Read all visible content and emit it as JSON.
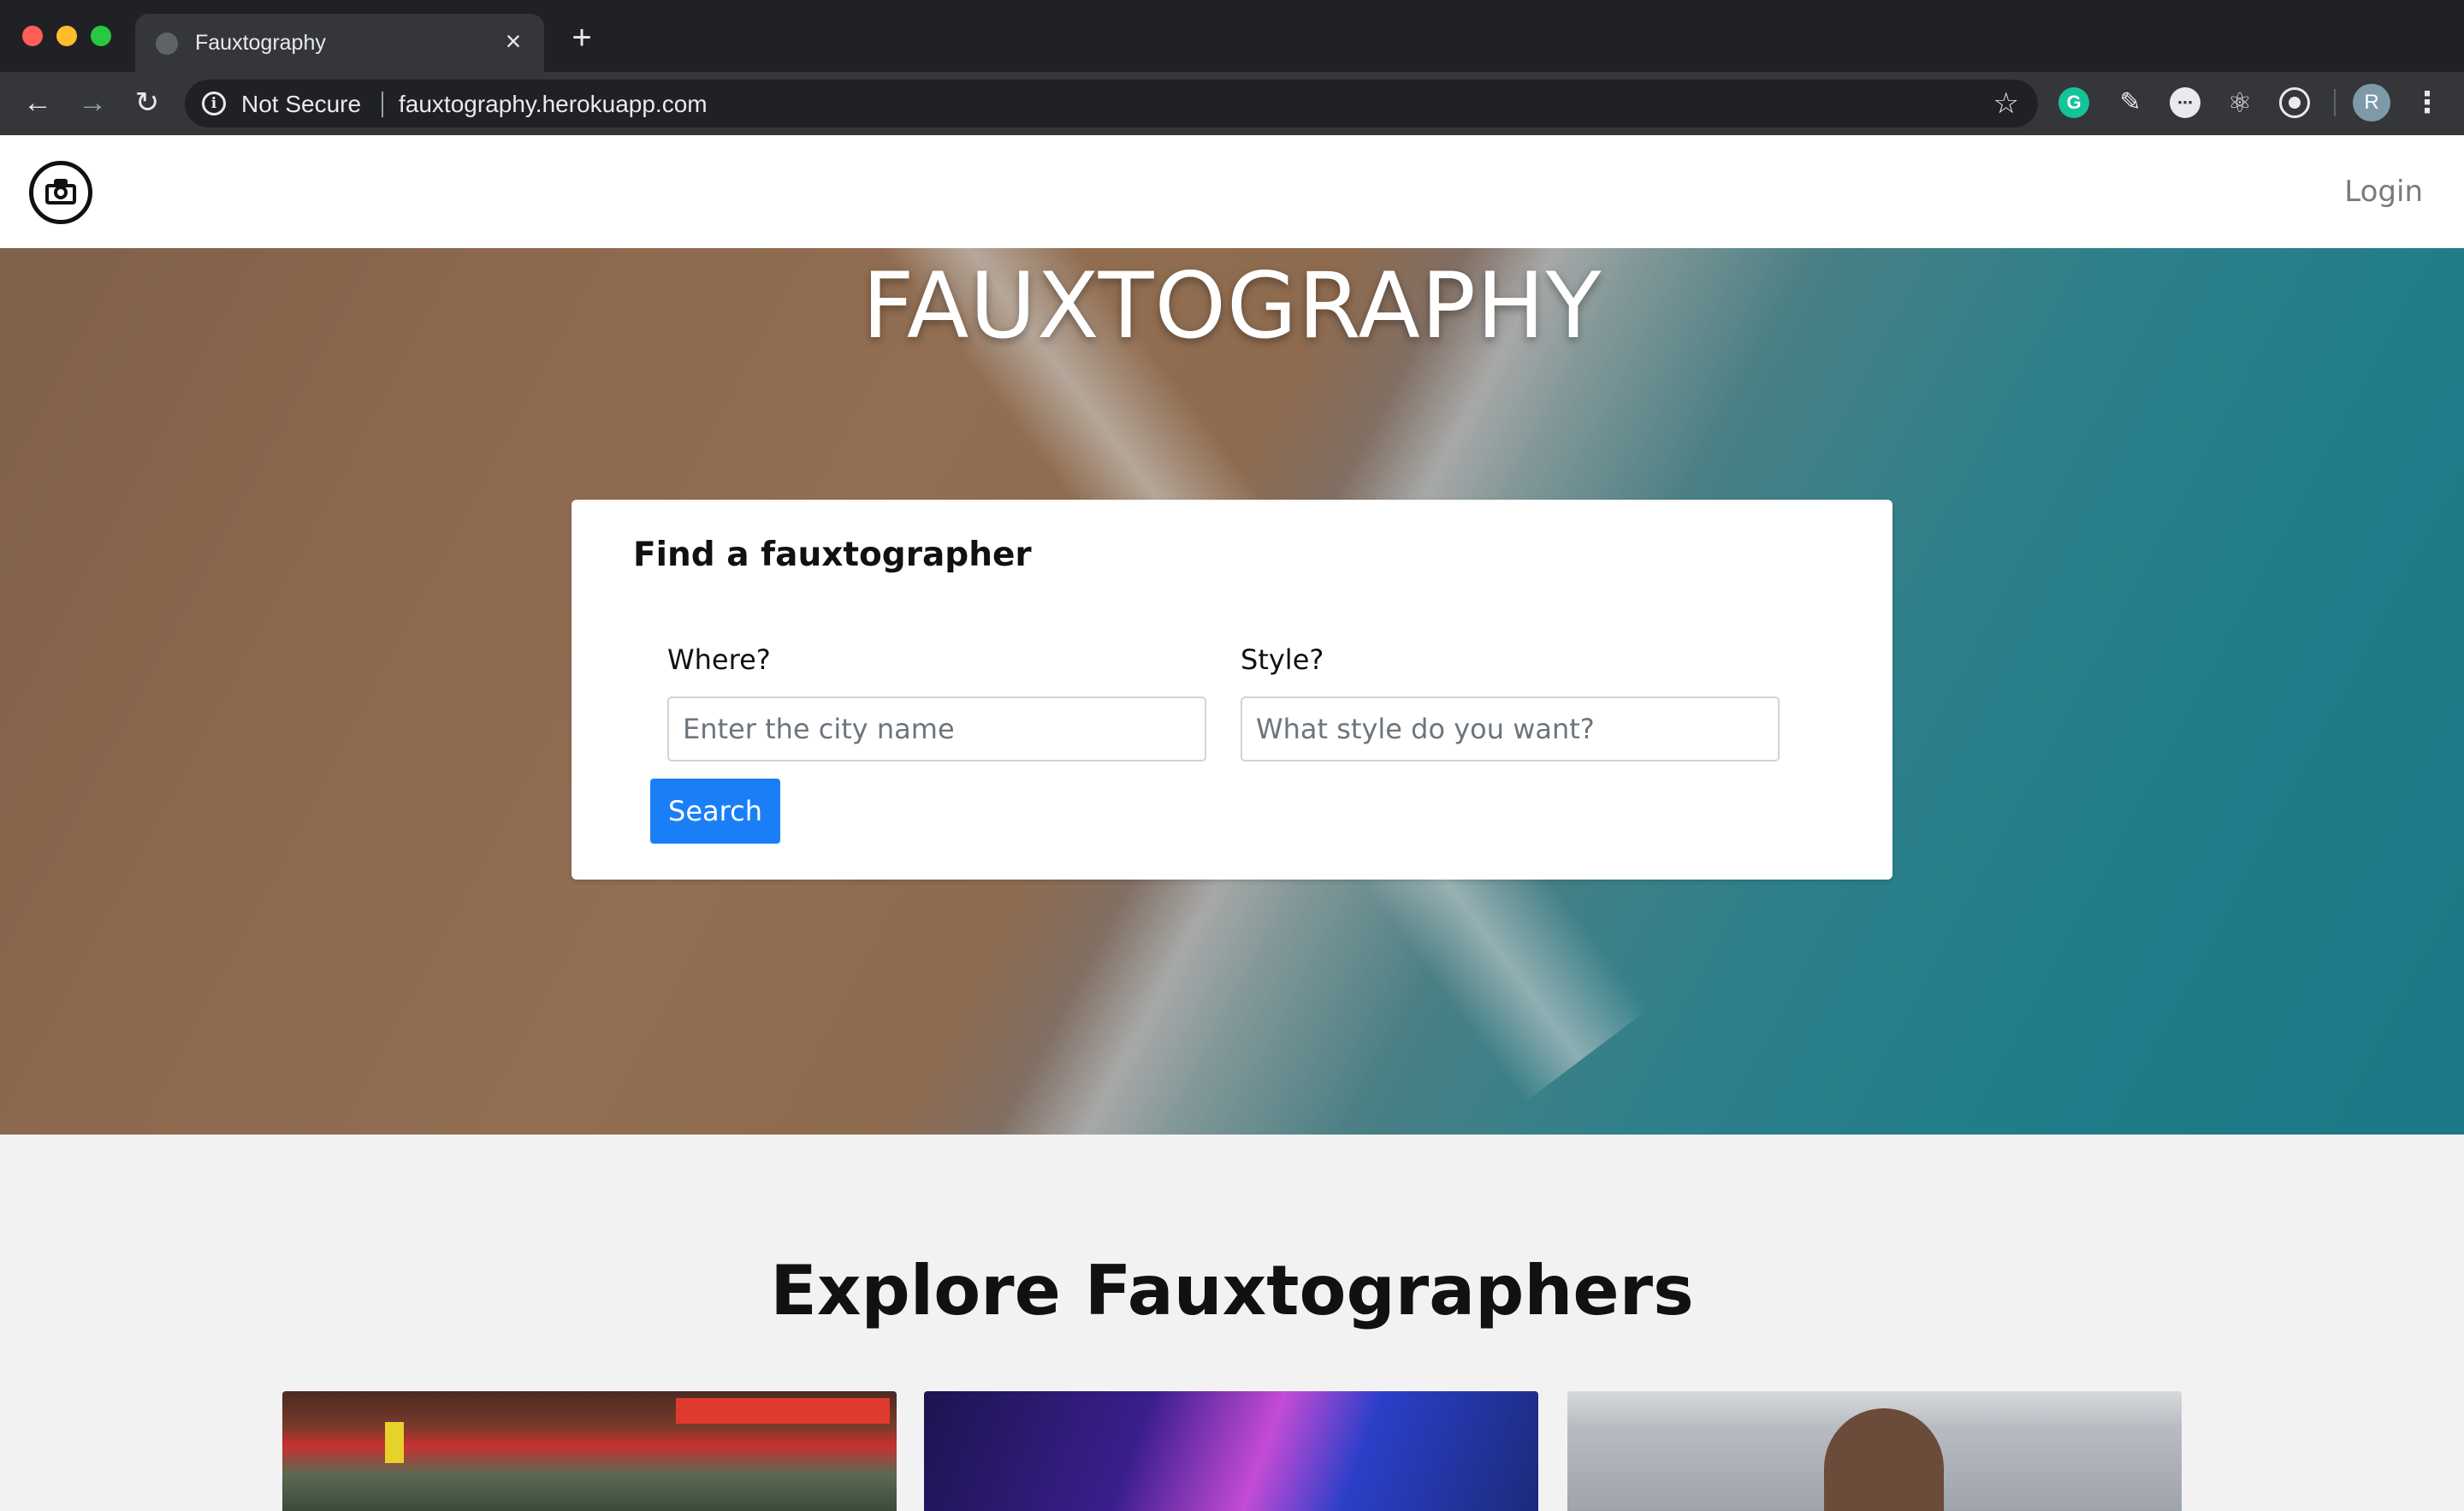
{
  "browser": {
    "tab_title": "Fauxtography",
    "tab_close": "×",
    "new_tab": "+",
    "security_label": "Not Secure",
    "url": "fauxtography.herokuapp.com",
    "profile_initial": "R"
  },
  "navbar": {
    "login_label": "Login"
  },
  "hero": {
    "title": "FAUXTOGRAPHY"
  },
  "search": {
    "title": "Find a fauxtographer",
    "where_label": "Where?",
    "where_placeholder": "Enter the city name",
    "style_label": "Style?",
    "style_placeholder": "What style do you want?",
    "button_label": "Search"
  },
  "explore": {
    "title": "Explore Fauxtographers",
    "cards": [
      {
        "icon": "city-street-photo"
      },
      {
        "icon": "neon-portrait-photo"
      },
      {
        "icon": "couple-beach-photo"
      }
    ]
  },
  "colors": {
    "accent": "#1a7ff7",
    "chrome_dark": "#202124",
    "chrome_toolbar": "#35363a"
  }
}
